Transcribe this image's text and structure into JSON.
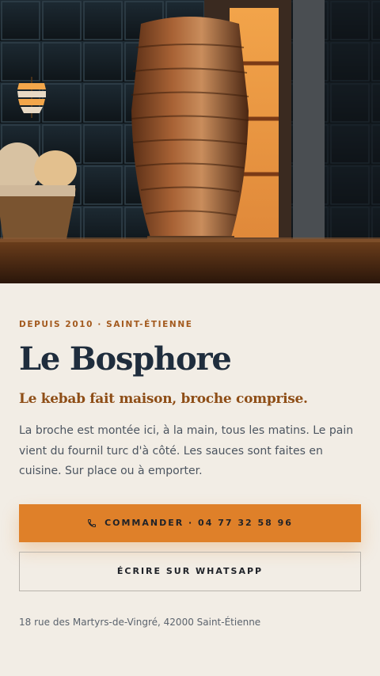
{
  "hero": {
    "image_alt": "Broche de kebab devant le grill vertical",
    "logo_icon": "doner-skewer-icon"
  },
  "eyebrow": "DEPUIS 2010 · SAINT-ÉTIENNE",
  "title": "Le Bosphore",
  "tagline": "Le kebab fait maison, broche comprise.",
  "description": "La broche est montée ici, à la main, tous les matins. Le pain vient du fournil turc d'à côté. Les sauces sont faites en cuisine. Sur place ou à emporter.",
  "actions": {
    "order_label": "COMMANDER · 04 77 32 58 96",
    "order_icon": "phone-icon",
    "whatsapp_label": "ÉCRIRE SUR WHATSAPP"
  },
  "address": "18 rue des Martyrs-de-Vingré, 42000 Saint-Étienne",
  "colors": {
    "accent": "#df8029",
    "title": "#1f2d3d",
    "tagline": "#8e4e17",
    "background": "#f2ede5"
  }
}
